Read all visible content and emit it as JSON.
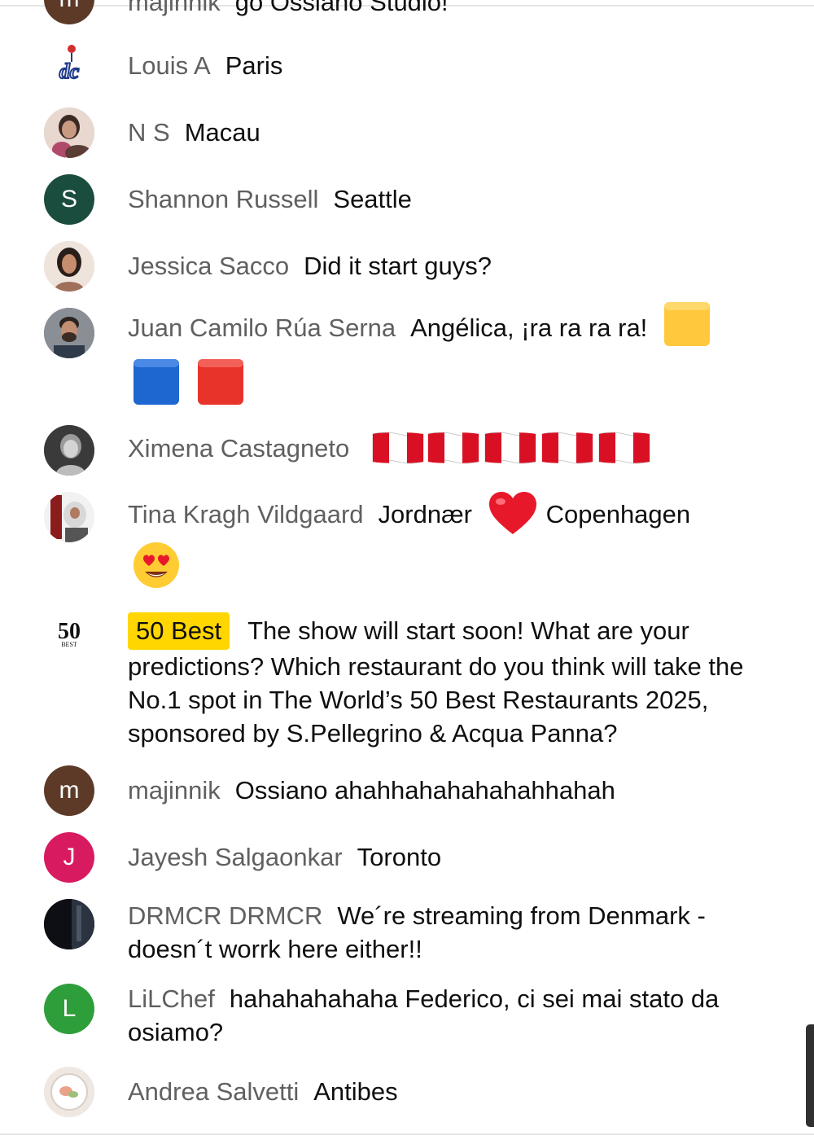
{
  "chat": {
    "messages": [
      {
        "author": "majinnik",
        "text": "go Ossiano Studio!",
        "avatar": {
          "type": "initial",
          "letter": "m",
          "color": "#5d3a28"
        }
      },
      {
        "author": "Louis A",
        "text": "Paris",
        "avatar": {
          "type": "logo",
          "icon": "dc-logo-icon"
        }
      },
      {
        "author": "N S",
        "text": "Macau",
        "avatar": {
          "type": "photo",
          "icon": "person-photo-icon"
        }
      },
      {
        "author": "Shannon Russell",
        "text": "Seattle",
        "avatar": {
          "type": "initial",
          "letter": "S",
          "color": "#1b4d3e"
        }
      },
      {
        "author": "Jessica Sacco",
        "text": "Did it start guys?",
        "avatar": {
          "type": "photo",
          "icon": "person-photo-icon"
        }
      },
      {
        "author": "Juan Camilo Rúa Serna",
        "text": "Angélica, ¡ra ra ra ra!",
        "emojis": [
          "yellow-square-icon",
          "blue-square-icon",
          "red-square-icon"
        ],
        "avatar": {
          "type": "photo",
          "icon": "person-photo-icon"
        }
      },
      {
        "author": "Ximena Castagneto",
        "text": "",
        "emojis": [
          "peru-flag-icon",
          "peru-flag-icon",
          "peru-flag-icon",
          "peru-flag-icon",
          "peru-flag-icon"
        ],
        "avatar": {
          "type": "photo",
          "icon": "person-photo-icon"
        }
      },
      {
        "author": "Tina Kragh Vildgaard",
        "text_before": "Jordnær",
        "text_after": "Copenhagen",
        "emojis": [
          "red-heart-icon",
          "heart-eyes-face-icon"
        ],
        "avatar": {
          "type": "photo",
          "icon": "person-photo-icon"
        }
      },
      {
        "author": "50 Best",
        "text": "The show will start soon! What are your predictions? Which restaurant do you think will take the No.1 spot in The World’s 50 Best Restaurants 2025, sponsored by S.Pellegrino & Acqua Panna?",
        "badge_color": "#ffd600",
        "avatar": {
          "type": "logo",
          "icon": "50-best-logo-icon"
        }
      },
      {
        "author": "majinnik",
        "text": "Ossiano ahahhahahahahahhahah",
        "avatar": {
          "type": "initial",
          "letter": "m",
          "color": "#5d3a28"
        }
      },
      {
        "author": "Jayesh Salgaonkar",
        "text": "Toronto",
        "avatar": {
          "type": "initial",
          "letter": "J",
          "color": "#d81b60"
        }
      },
      {
        "author": "DRMCR DRMCR",
        "text": "We´re streaming from Denmark - doesn´t worrk here either!!",
        "avatar": {
          "type": "photo",
          "icon": "dark-photo-icon"
        }
      },
      {
        "author": "LiLChef",
        "text": "hahahahahaha Federico, ci sei mai stato da osiamo?",
        "avatar": {
          "type": "initial",
          "letter": "L",
          "color": "#2e9e3a"
        }
      },
      {
        "author": "Andrea Salvetti",
        "text": "Antibes",
        "avatar": {
          "type": "photo",
          "icon": "food-photo-icon"
        }
      }
    ]
  },
  "colors": {
    "author_text": "#606060",
    "message_text": "#0f0f0f",
    "owner_badge": "#ffd600"
  }
}
